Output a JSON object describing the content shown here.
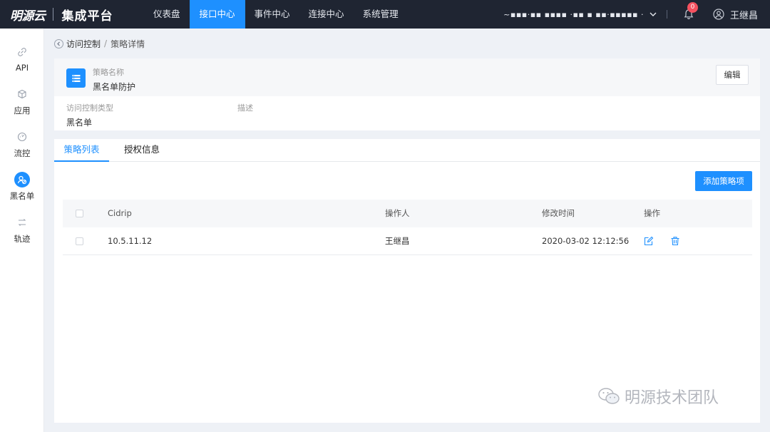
{
  "brand": {
    "logo": "明源云",
    "name": "集成平台"
  },
  "topnav": [
    {
      "label": "仪表盘",
      "active": false
    },
    {
      "label": "接口中心",
      "active": true
    },
    {
      "label": "事件中心",
      "active": false
    },
    {
      "label": "连接中心",
      "active": false
    },
    {
      "label": "系统管理",
      "active": false
    }
  ],
  "header_right": {
    "org_name": "~▪▪▪·▪▪ ▪▪▪▪ ·▪▪ ▪ ▪▪·▪▪▪▪▪ ·",
    "notification_count": "0",
    "user_name": "王继昌"
  },
  "sidebar": {
    "items": [
      {
        "label": "API",
        "icon": "link-icon",
        "active": false
      },
      {
        "label": "应用",
        "icon": "cube-icon",
        "active": false
      },
      {
        "label": "流控",
        "icon": "gauge-icon",
        "active": false
      },
      {
        "label": "黑名单",
        "icon": "blacklist-icon",
        "active": true
      },
      {
        "label": "轨迹",
        "icon": "trace-icon",
        "active": false
      }
    ]
  },
  "breadcrumb": {
    "parent": "访问控制",
    "separator": "/",
    "current": "策略详情"
  },
  "strategy": {
    "name_label": "策略名称",
    "name_value": "黑名单防护",
    "edit_label": "编辑",
    "type_label": "访问控制类型",
    "type_value": "黑名单",
    "desc_label": "描述",
    "desc_value": ""
  },
  "tabs": [
    {
      "label": "策略列表",
      "active": true
    },
    {
      "label": "授权信息",
      "active": false
    }
  ],
  "add_button": "添加策略项",
  "table": {
    "columns": [
      "Cidrip",
      "操作人",
      "修改时间",
      "操作"
    ],
    "rows": [
      {
        "cidrip": "10.5.11.12",
        "operator": "王继昌",
        "modified": "2020-03-02 12:12:56"
      }
    ]
  },
  "watermark": "明源技术团队",
  "colors": {
    "accent": "#1e90ff",
    "topbar": "#1f2532",
    "badge": "#f5515f"
  }
}
